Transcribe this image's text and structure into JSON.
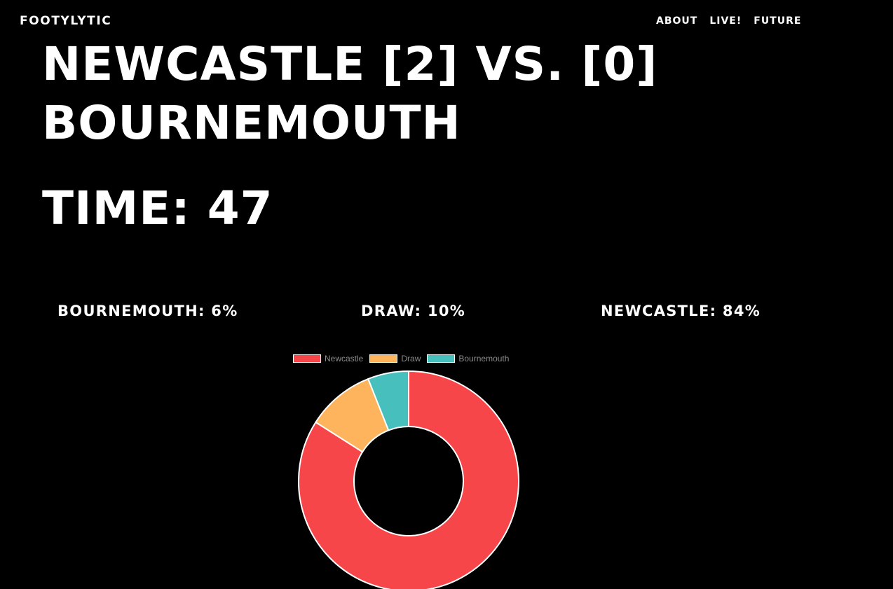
{
  "nav": {
    "brand": "FOOTYLYTIC",
    "links": [
      "ABOUT",
      "LIVE!",
      "FUTURE"
    ]
  },
  "match": {
    "headline": "NEWCASTLE [2] VS. [0] BOURNEMOUTH",
    "time_text": "TIME: 47"
  },
  "probabilities": {
    "away_label": "BOURNEMOUTH: 6%",
    "draw_label": "DRAW: 10%",
    "home_label": "NEWCASTLE: 84%"
  },
  "chart_data": {
    "type": "pie",
    "style": "doughnut",
    "title": "",
    "legend_position": "top",
    "labels": [
      "Newcastle",
      "Draw",
      "Bournemouth"
    ],
    "values": [
      84,
      10,
      6
    ],
    "colors": [
      "#f7464a",
      "#fdb45c",
      "#46bfbd"
    ]
  }
}
